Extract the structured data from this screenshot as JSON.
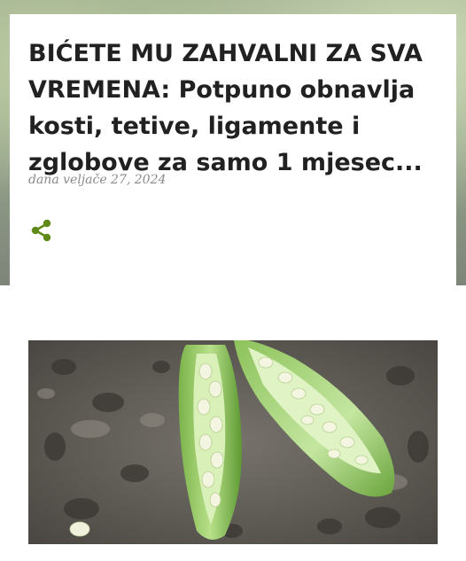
{
  "post": {
    "title": "BIĆETE MU ZAHVALNI ZA SVA VREMENA: Potpuno obnavlja kosti, tetive, ligamente i zglobove za samo 1 mjesec...",
    "date": "dana veljače 27, 2024",
    "share_icon": "share-icon",
    "accent_color": "#5f8a17"
  },
  "image": {
    "subject": "okra-pods-with-seeds-icon"
  }
}
